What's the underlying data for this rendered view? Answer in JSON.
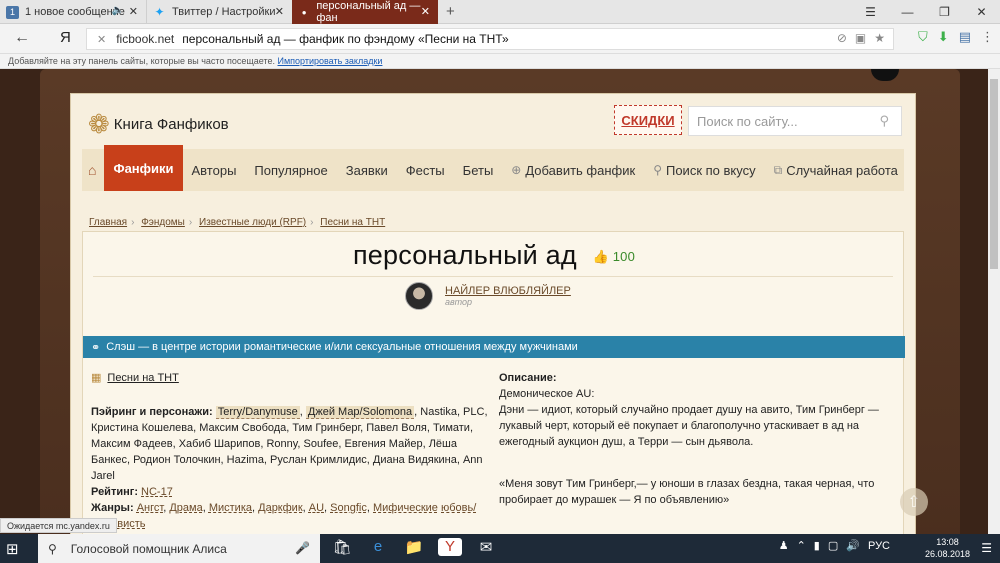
{
  "tabs": [
    {
      "label": "1 новое сообщение",
      "icon": "vk-icon"
    },
    {
      "label": "Твиттер / Настройки",
      "icon": "twitter-icon"
    },
    {
      "label": "персональный ад — фан",
      "icon": "ficbook-icon"
    }
  ],
  "address": {
    "domain": "ficbook.net",
    "title": "персональный ад — фанфик по фэндому «Песни на ТНТ»"
  },
  "bookmarks": {
    "hint": "Добавляйте на эту панель сайты, которые вы часто посещаете.",
    "import_link": "Импортировать закладки"
  },
  "site": {
    "logo": "Книга Фанфиков",
    "sale": "СКИДКИ",
    "search_placeholder": "Поиск по сайту...",
    "menu": [
      "Фанфики",
      "Авторы",
      "Популярное",
      "Заявки",
      "Фесты",
      "Беты"
    ],
    "menu_actions": [
      "Добавить фанфик",
      "Поиск по вкусу",
      "Случайная работа"
    ]
  },
  "breadcrumbs": [
    "Главная",
    "Фэндомы",
    "Известные люди (RPF)",
    "Песни на ТНТ"
  ],
  "work": {
    "title": "персональный ад",
    "likes": "100",
    "author_name": "НАЙЛЕР ВЛЮБЛЯЙЛЕР",
    "author_role": "автор",
    "direction": "Слэш — в центре истории романтические и/или сексуальные отношения между мужчинами",
    "fandom": "Песни на ТНТ",
    "pairing_label": "Пэйринг и персонажи:",
    "pairing_tag1": "Terry/Danymuse",
    "pairing_tag2": "Джей Мар/Solomona",
    "pairing_rest": ", Nastika, PLC, Кристина Кошелева, Максим Свобода, Тим Гринберг, Павел Воля, Тимати, Максим Фадеев, Хабиб Шарипов, Ronny, Soufee, Евгения Майер, Лёша Банкес, Родион Толочкин, Hazima, Руслан Кримлидис, Диана Видякина, Ann Jarel",
    "rating_label": "Рейтинг:",
    "rating": "NC-17",
    "genres_label": "Жанры:",
    "genres": [
      "Ангст",
      "Драма",
      "Мистика",
      "Даркфик",
      "AU",
      "Songfic",
      "Мифические",
      "юбовь/Ненависть"
    ],
    "desc_label": "Описание:",
    "desc_line1": "Демоническое AU:",
    "desc_body": "Дэни — идиот, который случайно продает душу на авито, Тим Гринберг — лукавый черт, который её покупает и благополучно утаскивает в ад на ежегодный аукцион душ, а Терри — сын дьявола.",
    "quote": "«Меня зовут Тим Гринберг,— у юноши в глазах бездна, такая черная, что пробирает до мурашек — Я по объявлению»"
  },
  "status_text": "Ожидается mc.yandex.ru",
  "taskbar": {
    "search": "Голосовой помощник Алиса",
    "lang": "РУС",
    "time": "13:08",
    "date": "26.08.2018"
  }
}
